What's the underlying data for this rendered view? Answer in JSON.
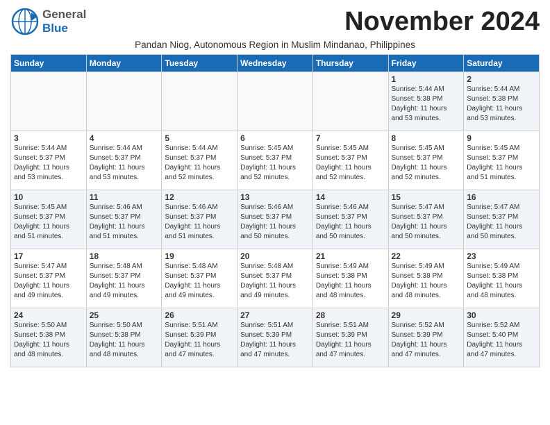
{
  "logo": {
    "line1": "General",
    "line2": "Blue"
  },
  "title": "November 2024",
  "subtitle": "Pandan Niog, Autonomous Region in Muslim Mindanao, Philippines",
  "days_of_week": [
    "Sunday",
    "Monday",
    "Tuesday",
    "Wednesday",
    "Thursday",
    "Friday",
    "Saturday"
  ],
  "weeks": [
    [
      {
        "day": "",
        "info": ""
      },
      {
        "day": "",
        "info": ""
      },
      {
        "day": "",
        "info": ""
      },
      {
        "day": "",
        "info": ""
      },
      {
        "day": "",
        "info": ""
      },
      {
        "day": "1",
        "info": "Sunrise: 5:44 AM\nSunset: 5:38 PM\nDaylight: 11 hours\nand 53 minutes."
      },
      {
        "day": "2",
        "info": "Sunrise: 5:44 AM\nSunset: 5:38 PM\nDaylight: 11 hours\nand 53 minutes."
      }
    ],
    [
      {
        "day": "3",
        "info": "Sunrise: 5:44 AM\nSunset: 5:37 PM\nDaylight: 11 hours\nand 53 minutes."
      },
      {
        "day": "4",
        "info": "Sunrise: 5:44 AM\nSunset: 5:37 PM\nDaylight: 11 hours\nand 53 minutes."
      },
      {
        "day": "5",
        "info": "Sunrise: 5:44 AM\nSunset: 5:37 PM\nDaylight: 11 hours\nand 52 minutes."
      },
      {
        "day": "6",
        "info": "Sunrise: 5:45 AM\nSunset: 5:37 PM\nDaylight: 11 hours\nand 52 minutes."
      },
      {
        "day": "7",
        "info": "Sunrise: 5:45 AM\nSunset: 5:37 PM\nDaylight: 11 hours\nand 52 minutes."
      },
      {
        "day": "8",
        "info": "Sunrise: 5:45 AM\nSunset: 5:37 PM\nDaylight: 11 hours\nand 52 minutes."
      },
      {
        "day": "9",
        "info": "Sunrise: 5:45 AM\nSunset: 5:37 PM\nDaylight: 11 hours\nand 51 minutes."
      }
    ],
    [
      {
        "day": "10",
        "info": "Sunrise: 5:45 AM\nSunset: 5:37 PM\nDaylight: 11 hours\nand 51 minutes."
      },
      {
        "day": "11",
        "info": "Sunrise: 5:46 AM\nSunset: 5:37 PM\nDaylight: 11 hours\nand 51 minutes."
      },
      {
        "day": "12",
        "info": "Sunrise: 5:46 AM\nSunset: 5:37 PM\nDaylight: 11 hours\nand 51 minutes."
      },
      {
        "day": "13",
        "info": "Sunrise: 5:46 AM\nSunset: 5:37 PM\nDaylight: 11 hours\nand 50 minutes."
      },
      {
        "day": "14",
        "info": "Sunrise: 5:46 AM\nSunset: 5:37 PM\nDaylight: 11 hours\nand 50 minutes."
      },
      {
        "day": "15",
        "info": "Sunrise: 5:47 AM\nSunset: 5:37 PM\nDaylight: 11 hours\nand 50 minutes."
      },
      {
        "day": "16",
        "info": "Sunrise: 5:47 AM\nSunset: 5:37 PM\nDaylight: 11 hours\nand 50 minutes."
      }
    ],
    [
      {
        "day": "17",
        "info": "Sunrise: 5:47 AM\nSunset: 5:37 PM\nDaylight: 11 hours\nand 49 minutes."
      },
      {
        "day": "18",
        "info": "Sunrise: 5:48 AM\nSunset: 5:37 PM\nDaylight: 11 hours\nand 49 minutes."
      },
      {
        "day": "19",
        "info": "Sunrise: 5:48 AM\nSunset: 5:37 PM\nDaylight: 11 hours\nand 49 minutes."
      },
      {
        "day": "20",
        "info": "Sunrise: 5:48 AM\nSunset: 5:37 PM\nDaylight: 11 hours\nand 49 minutes."
      },
      {
        "day": "21",
        "info": "Sunrise: 5:49 AM\nSunset: 5:38 PM\nDaylight: 11 hours\nand 48 minutes."
      },
      {
        "day": "22",
        "info": "Sunrise: 5:49 AM\nSunset: 5:38 PM\nDaylight: 11 hours\nand 48 minutes."
      },
      {
        "day": "23",
        "info": "Sunrise: 5:49 AM\nSunset: 5:38 PM\nDaylight: 11 hours\nand 48 minutes."
      }
    ],
    [
      {
        "day": "24",
        "info": "Sunrise: 5:50 AM\nSunset: 5:38 PM\nDaylight: 11 hours\nand 48 minutes."
      },
      {
        "day": "25",
        "info": "Sunrise: 5:50 AM\nSunset: 5:38 PM\nDaylight: 11 hours\nand 48 minutes."
      },
      {
        "day": "26",
        "info": "Sunrise: 5:51 AM\nSunset: 5:39 PM\nDaylight: 11 hours\nand 47 minutes."
      },
      {
        "day": "27",
        "info": "Sunrise: 5:51 AM\nSunset: 5:39 PM\nDaylight: 11 hours\nand 47 minutes."
      },
      {
        "day": "28",
        "info": "Sunrise: 5:51 AM\nSunset: 5:39 PM\nDaylight: 11 hours\nand 47 minutes."
      },
      {
        "day": "29",
        "info": "Sunrise: 5:52 AM\nSunset: 5:39 PM\nDaylight: 11 hours\nand 47 minutes."
      },
      {
        "day": "30",
        "info": "Sunrise: 5:52 AM\nSunset: 5:40 PM\nDaylight: 11 hours\nand 47 minutes."
      }
    ]
  ]
}
